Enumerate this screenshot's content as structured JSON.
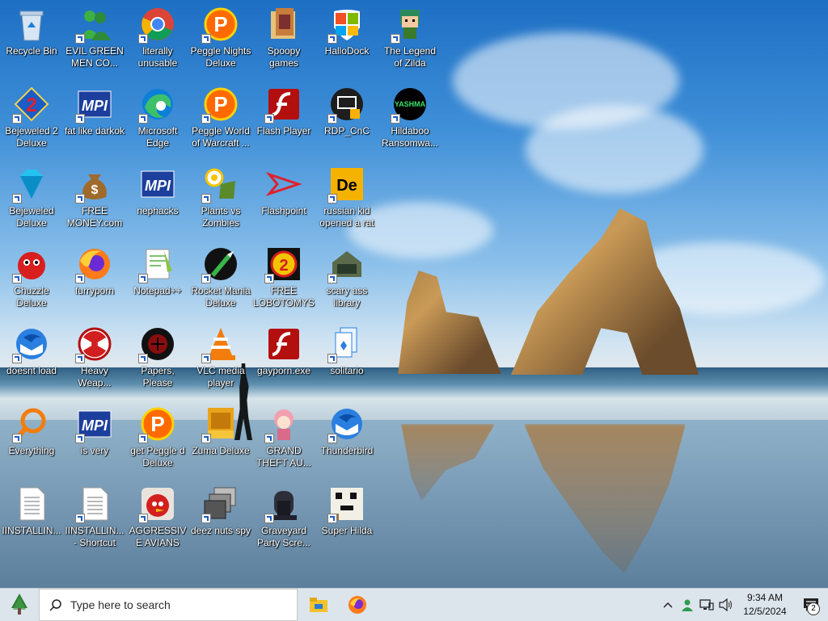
{
  "desktop": {
    "icons": [
      {
        "label": "Recycle Bin",
        "icon": "recycle-bin-icon",
        "shortcut": false
      },
      {
        "label": "EVIL GREEN MEN CO...",
        "icon": "green-men-icon",
        "shortcut": true
      },
      {
        "label": "literally unusable",
        "icon": "chrome-icon",
        "shortcut": true
      },
      {
        "label": "Peggle Nights Deluxe",
        "icon": "peggle-nights-icon",
        "shortcut": true
      },
      {
        "label": "Spoopy games",
        "icon": "folder-icon",
        "shortcut": false
      },
      {
        "label": "HalloDock",
        "icon": "windows-logo-icon",
        "shortcut": true
      },
      {
        "label": "The Legend of Zilda",
        "icon": "zelda-icon",
        "shortcut": true
      },
      {
        "label": "Bejeweled 2 Deluxe",
        "icon": "bejeweled2-icon",
        "shortcut": true
      },
      {
        "label": "fat like darkok",
        "icon": "mpi-icon",
        "shortcut": true
      },
      {
        "label": "Microsoft Edge",
        "icon": "edge-icon",
        "shortcut": true
      },
      {
        "label": "Peggle World of Warcraft ...",
        "icon": "peggle-icon",
        "shortcut": true
      },
      {
        "label": "Flash Player",
        "icon": "flash-icon",
        "shortcut": true
      },
      {
        "label": "RDP_CnC",
        "icon": "rdp-icon",
        "shortcut": true
      },
      {
        "label": "Hildaboo Ransomwa...",
        "icon": "yashma-icon",
        "shortcut": true
      },
      {
        "label": "Bejeweled Deluxe",
        "icon": "gem-icon",
        "shortcut": true
      },
      {
        "label": "FREE MONEY.com",
        "icon": "money-bag-icon",
        "shortcut": true
      },
      {
        "label": "nephacks",
        "icon": "mpi-icon",
        "shortcut": false
      },
      {
        "label": "Plants vs Zombies",
        "icon": "plants-vs-zombies-icon",
        "shortcut": true
      },
      {
        "label": "Flashpoint",
        "icon": "flashpoint-icon",
        "shortcut": false
      },
      {
        "label": "russian kid opened a rat",
        "icon": "de-icon",
        "shortcut": true
      },
      {
        "label": "Chuzzle Deluxe",
        "icon": "chuzzle-icon",
        "shortcut": true
      },
      {
        "label": "furryporn",
        "icon": "firefox-icon",
        "shortcut": true
      },
      {
        "label": "Notepad++",
        "icon": "notepadpp-icon",
        "shortcut": true
      },
      {
        "label": "Rocket Mania Deluxe",
        "icon": "rocket-icon",
        "shortcut": true
      },
      {
        "label": "FREE LOBOTOMYS",
        "icon": "lobotomy-icon",
        "shortcut": true
      },
      {
        "label": "scary ass library",
        "icon": "library-icon",
        "shortcut": true
      },
      {
        "label": "doesnt load",
        "icon": "thunderbird-icon",
        "shortcut": true
      },
      {
        "label": "Heavy Weap...",
        "icon": "radiation-icon",
        "shortcut": true
      },
      {
        "label": "Papers, Please",
        "icon": "papers-please-icon",
        "shortcut": true
      },
      {
        "label": "VLC media player",
        "icon": "vlc-icon",
        "shortcut": true
      },
      {
        "label": "gayporn.exe",
        "icon": "flash-icon",
        "shortcut": false
      },
      {
        "label": "solitario",
        "icon": "solitaire-icon",
        "shortcut": true
      },
      {
        "label": "Everything",
        "icon": "search-icon",
        "shortcut": true
      },
      {
        "label": "is very",
        "icon": "mpi-shield-icon",
        "shortcut": true
      },
      {
        "label": "get Peggle d Deluxe",
        "icon": "peggle-icon",
        "shortcut": true
      },
      {
        "label": "Zuma Deluxe",
        "icon": "zuma-icon",
        "shortcut": true
      },
      {
        "label": "GRAND THEFT AU...",
        "icon": "anime-girl-icon",
        "shortcut": true
      },
      {
        "label": "Thunderbird",
        "icon": "thunderbird-icon",
        "shortcut": true
      },
      {
        "label": "IINSTALLIN...",
        "icon": "text-file-icon",
        "shortcut": false
      },
      {
        "label": "IINSTALLIN... - Shortcut",
        "icon": "text-file-icon",
        "shortcut": true
      },
      {
        "label": "AGGRESSIVE AVIANS",
        "icon": "angry-bird-icon",
        "shortcut": true
      },
      {
        "label": "deez nuts spy",
        "icon": "stack-icon",
        "shortcut": true
      },
      {
        "label": "Graveyard Party Scre...",
        "icon": "graveyard-icon",
        "shortcut": true
      },
      {
        "label": "Super Hilda",
        "icon": "pixel-art-icon",
        "shortcut": true
      }
    ]
  },
  "taskbar": {
    "search_placeholder": "Type here to search",
    "apps": [
      {
        "name": "file-explorer-icon"
      },
      {
        "name": "firefox-icon"
      }
    ],
    "clock_time": "9:34 AM",
    "clock_date": "12/5/2024",
    "notification_count": "2"
  }
}
